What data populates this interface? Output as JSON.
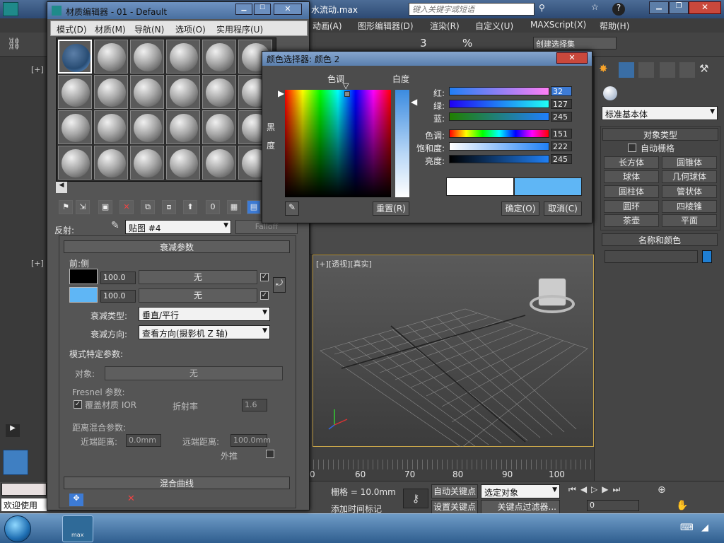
{
  "app": {
    "title_fragment": "水流动.max",
    "search_placeholder": "键入关键字或短语",
    "menu": [
      "动画(A)",
      "图形编辑器(D)",
      "渲染(R)",
      "自定义(U)",
      "MAXScript(X)",
      "帮助(H)"
    ],
    "selection_set": "创建选择集",
    "viewport_top_label": "[+]",
    "viewport_left_label": "[+]",
    "persp_label": "[+][透视][真实]",
    "timeline_ticks": [
      "0",
      "60",
      "70",
      "80",
      "90",
      "100"
    ],
    "status": {
      "welcome": "欢迎使用",
      "grid": "栅格 = 10.0mm",
      "add_time_tag": "添加时间标记",
      "auto_key": "自动关键点",
      "set_key": "设置关键点",
      "selected_object": "选定对象",
      "key_filters": "关键点过滤器...",
      "frame": "0"
    },
    "taskbar_app": "max"
  },
  "command_panel": {
    "dropdown": "标准基本体",
    "object_type_header": "对象类型",
    "auto_grid": "自动栅格",
    "buttons": [
      "长方体",
      "圆锥体",
      "球体",
      "几何球体",
      "圆柱体",
      "管状体",
      "圆环",
      "四棱锥",
      "茶壶",
      "平面"
    ],
    "name_color_header": "名称和颜色",
    "name_value": "",
    "color_swatch": "#1f7fd4"
  },
  "material_editor": {
    "title": "材质编辑器 - 01 - Default",
    "menu": [
      "模式(D)",
      "材质(M)",
      "导航(N)",
      "选项(O)",
      "实用程序(U)"
    ],
    "reflect_label": "反射:",
    "map_dropdown": "贴图 #4",
    "falloff_btn": "Falloff",
    "rollout_falloff": "衰减参数",
    "front_side": "前:侧",
    "row1": {
      "color": "#000000",
      "value": "100.0",
      "map": "无"
    },
    "row2": {
      "color": "#5fb6f5",
      "value": "100.0",
      "map": "无"
    },
    "falloff_type_label": "衰减类型:",
    "falloff_type_value": "垂直/平行",
    "falloff_dir_label": "衰减方向:",
    "falloff_dir_value": "查看方向(摄影机 Z 轴)",
    "mode_params": "模式特定参数:",
    "object_label": "对象:",
    "object_value": "无",
    "fresnel_label": "Fresnel 参数:",
    "override_ior": "覆盖材质 IOR",
    "ior_label": "折射率",
    "ior_value": "1.6",
    "dist_blend": "距离混合参数:",
    "near_label": "近端距离:",
    "near_value": "0.0mm",
    "far_label": "远端距离:",
    "far_value": "100.0mm",
    "extrapolate": "外推",
    "mix_curve": "混合曲线"
  },
  "color_selector": {
    "title": "颜色选择器: 颜色 2",
    "hue_label": "色调",
    "whiteness_label": "白度",
    "blackness_label": "黑度",
    "red_label": "红:",
    "red_value": "32",
    "green_label": "绿:",
    "green_value": "127",
    "blue_label": "蓝:",
    "blue_value": "245",
    "hue2_label": "色调:",
    "hue_value": "151",
    "sat_label": "饱和度:",
    "sat_value": "222",
    "bright_label": "亮度:",
    "bright_value": "245",
    "reset_btn": "重置(R)",
    "ok_btn": "确定(O)",
    "cancel_btn": "取消(C)",
    "old_color": "#ffffff",
    "new_color": "#5fb6f5"
  }
}
